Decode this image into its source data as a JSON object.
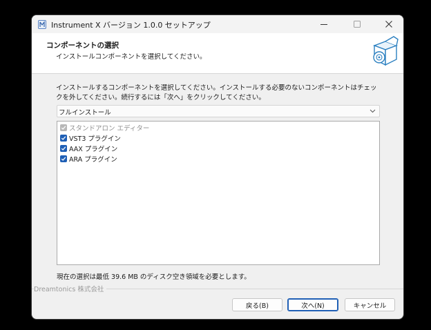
{
  "window": {
    "title": "Instrument X バージョン 1.0.0 セットアップ",
    "controls": {
      "minimize_icon": "minimize-icon",
      "maximize_icon": "maximize-icon",
      "close_icon": "close-icon"
    }
  },
  "header": {
    "title": "コンポーネントの選択",
    "subtitle": "インストールコンポーネントを選択してください。",
    "graphic_icon": "software-box-icon"
  },
  "main": {
    "instruction": "インストールするコンポーネントを選択してください。インストールする必要のないコンポーネントはチェックを外してください。続行するには「次へ」をクリックしてください。",
    "install_type": {
      "selected": "フルインストール"
    },
    "components": [
      {
        "label": "スタンドアロン エディター",
        "checked": true,
        "enabled": false
      },
      {
        "label": "VST3 プラグイン",
        "checked": true,
        "enabled": true
      },
      {
        "label": "AAX プラグイン",
        "checked": true,
        "enabled": true
      },
      {
        "label": "ARA プラグイン",
        "checked": true,
        "enabled": true
      }
    ],
    "space_required": "現在の選択は最低 39.6 MB のディスク空き領域を必要とします。"
  },
  "footer": {
    "company": "Dreamtonics 株式会社",
    "back_label": "戻る(B)",
    "next_label": "次へ(N)",
    "cancel_label": "キャンセル"
  },
  "colors": {
    "accent": "#1f5fb5",
    "window_bg": "#f0f0f0",
    "desktop": "#000000"
  }
}
